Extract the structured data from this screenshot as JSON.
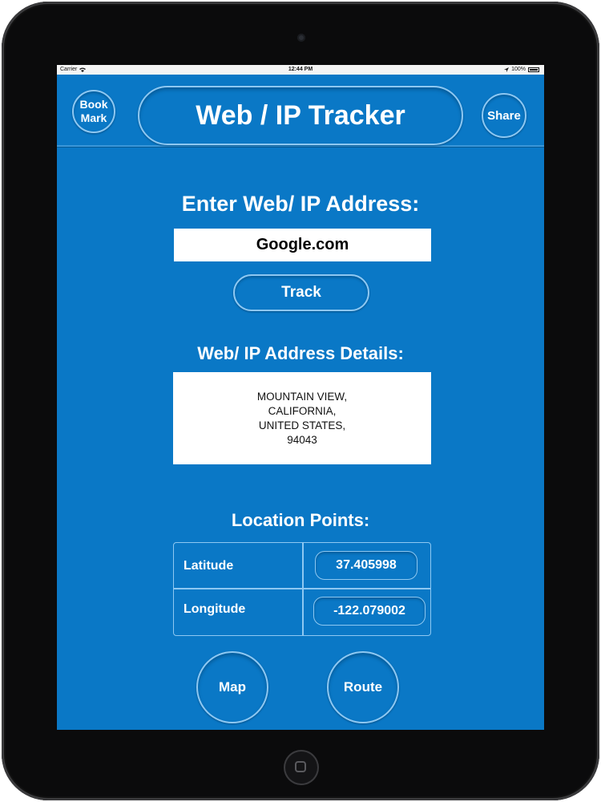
{
  "status_bar": {
    "carrier": "Carrier",
    "time": "12:44 PM",
    "battery": "100%"
  },
  "header": {
    "bookmark_line1": "Book",
    "bookmark_line2": "Mark",
    "title": "Web / IP Tracker",
    "share_label": "Share"
  },
  "search": {
    "label": "Enter Web/ IP Address:",
    "value": "Google.com",
    "track_label": "Track"
  },
  "details": {
    "label": "Web/ IP Address Details:",
    "lines": [
      "MOUNTAIN VIEW,",
      "CALIFORNIA,",
      "UNITED STATES,",
      "94043"
    ]
  },
  "location": {
    "label": "Location Points:",
    "latitude_label": "Latitude",
    "latitude_value": "37.405998",
    "longitude_label": "Longitude",
    "longitude_value": "-122.079002"
  },
  "actions": {
    "map_label": "Map",
    "route_label": "Route"
  }
}
